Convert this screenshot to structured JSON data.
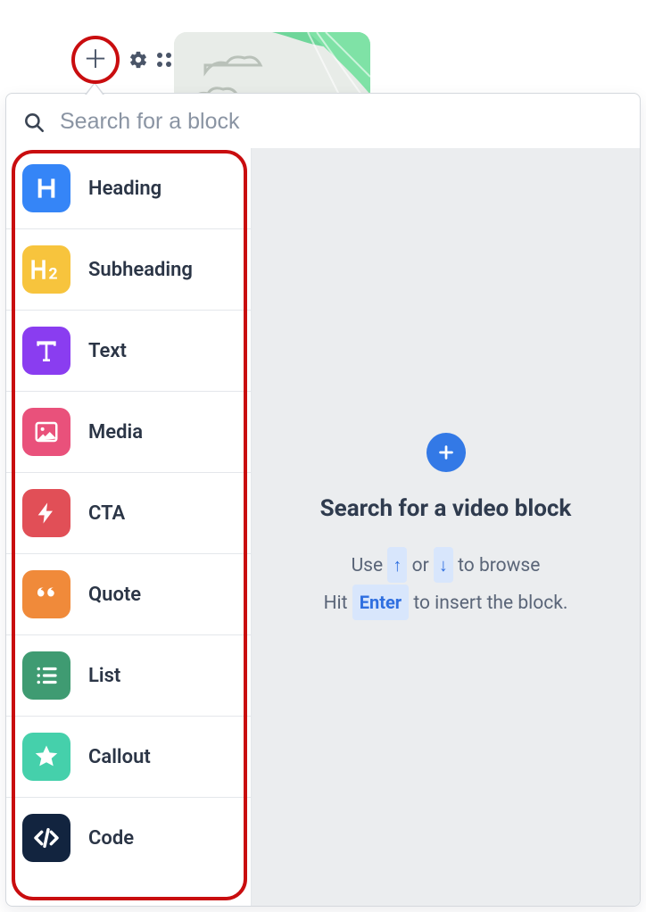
{
  "search": {
    "placeholder": "Search for a block",
    "value": ""
  },
  "blocks": [
    {
      "id": "heading",
      "label": "Heading",
      "color": "#3585f7",
      "icon": "heading"
    },
    {
      "id": "subheading",
      "label": "Subheading",
      "color": "#f7c43d",
      "icon": "subheading"
    },
    {
      "id": "text",
      "label": "Text",
      "color": "#8a3df0",
      "icon": "text"
    },
    {
      "id": "media",
      "label": "Media",
      "color": "#e9517b",
      "icon": "media"
    },
    {
      "id": "cta",
      "label": "CTA",
      "color": "#e14f57",
      "icon": "bolt"
    },
    {
      "id": "quote",
      "label": "Quote",
      "color": "#f08a3a",
      "icon": "quote"
    },
    {
      "id": "list",
      "label": "List",
      "color": "#3f9b72",
      "icon": "list"
    },
    {
      "id": "callout",
      "label": "Callout",
      "color": "#45d0ab",
      "icon": "star"
    },
    {
      "id": "code",
      "label": "Code",
      "color": "#12243f",
      "icon": "code"
    }
  ],
  "preview": {
    "title": "Search for a video block",
    "hint_prefix": "Use ",
    "hint_or": " or ",
    "hint_suffix": " to browse",
    "hint2_prefix": "Hit ",
    "hint2_suffix": " to insert the block.",
    "key_up": "↑",
    "key_down": "↓",
    "key_enter": "Enter"
  }
}
